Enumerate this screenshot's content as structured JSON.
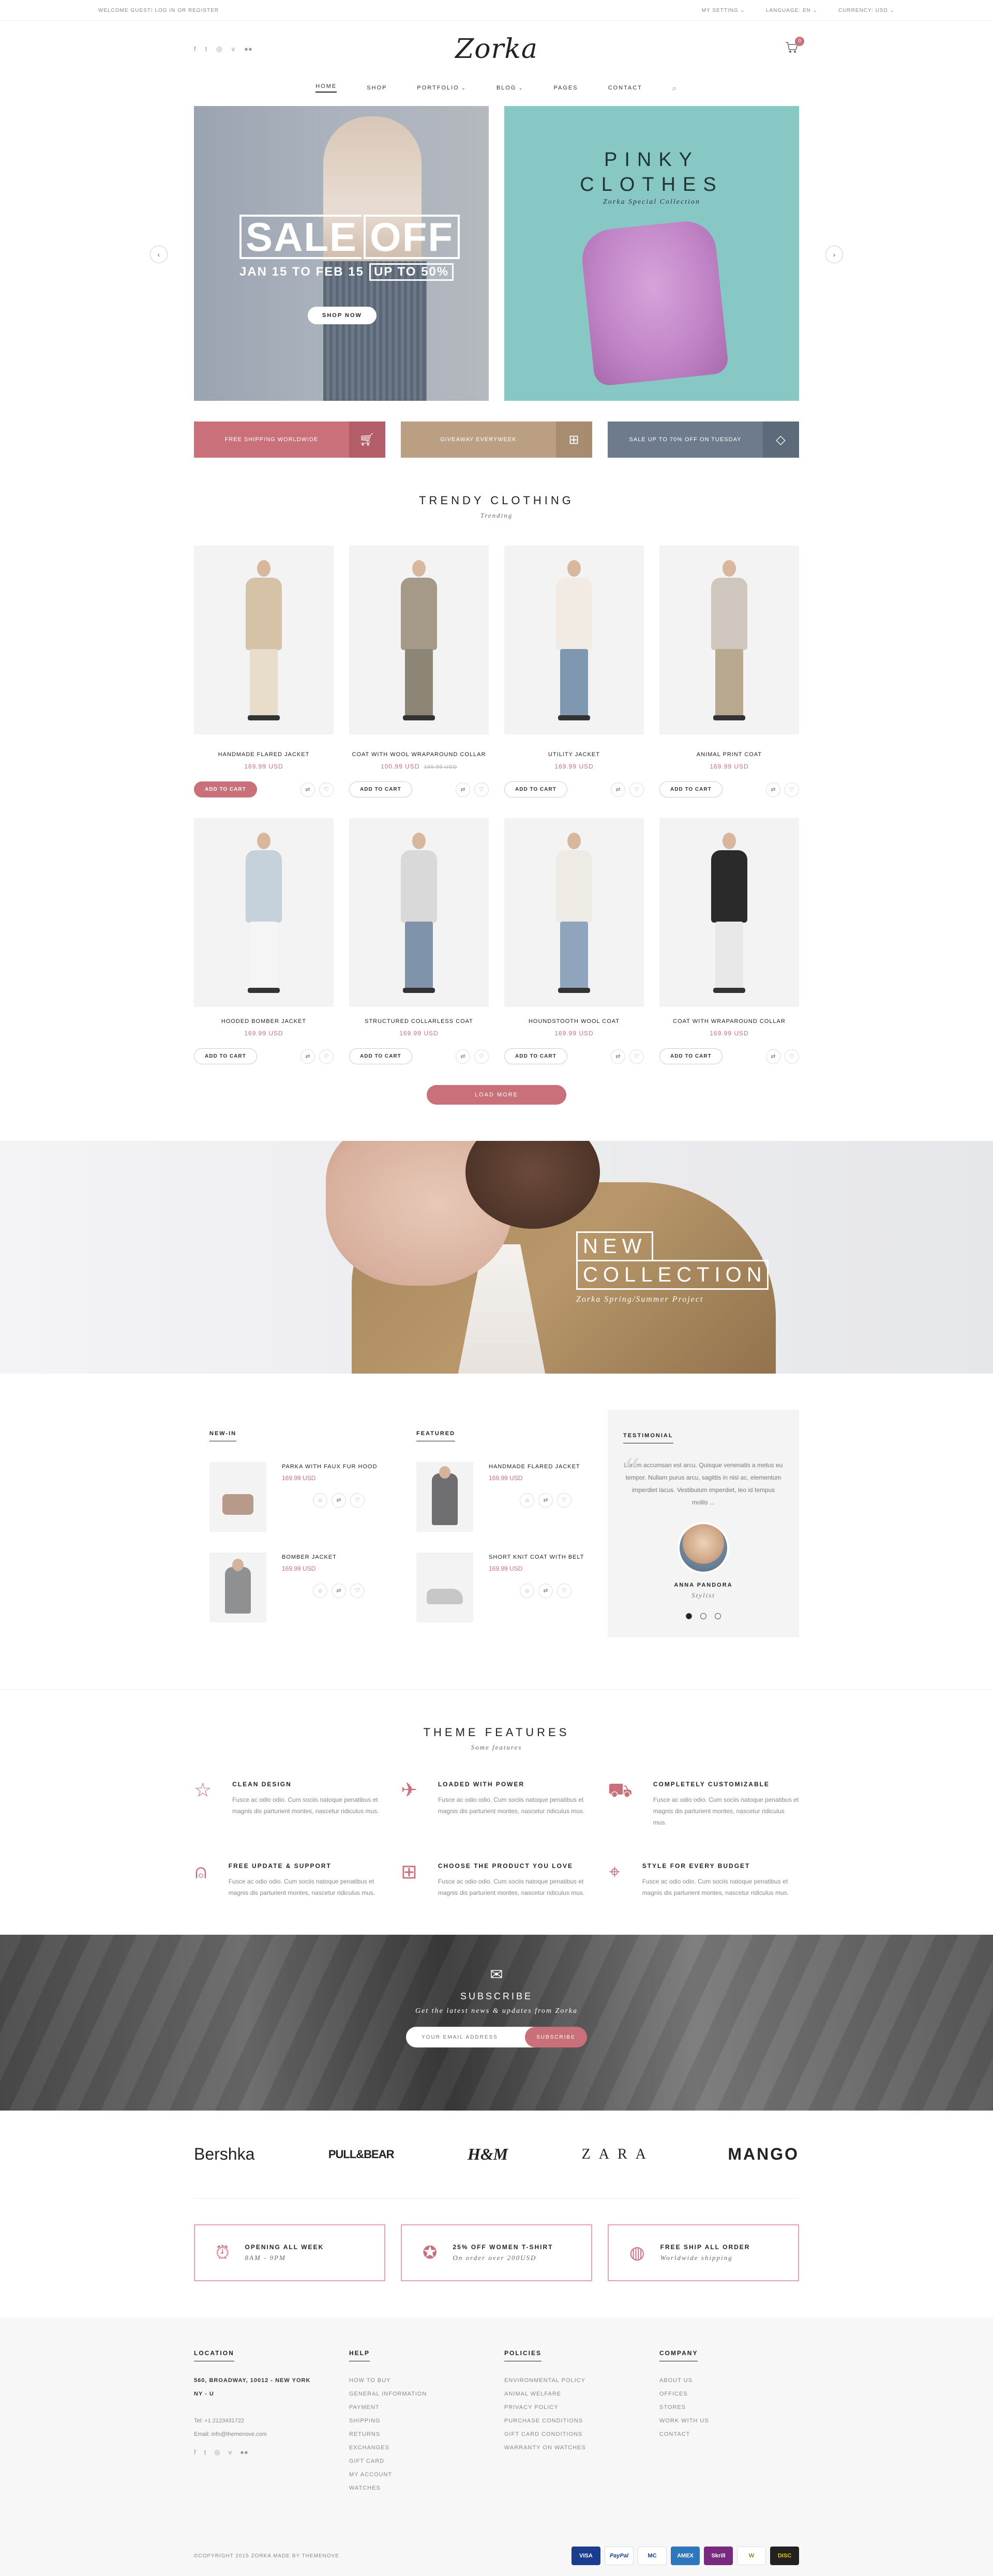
{
  "topbar": {
    "welcome": "WELCOME GUEST! LOG IN OR REGISTER",
    "my_setting": "MY SETTING",
    "language": "LANGUAGE: EN",
    "currency": "CURRENCY: USD"
  },
  "header": {
    "logo": "Zorka",
    "cart_count": "0"
  },
  "nav": {
    "items": [
      "HOME",
      "SHOP",
      "PORTFOLIO",
      "BLOG",
      "PAGES",
      "CONTACT"
    ]
  },
  "hero": {
    "sale_word1": "SALE",
    "sale_word2": "OFF",
    "dates": "JAN 15 TO FEB 15",
    "discount": "UP TO 50%",
    "shop_now": "SHOP NOW",
    "pinky_line1": "PINKY",
    "pinky_line2": "CLOTHES",
    "pinky_sub": "Zorka Special Collection"
  },
  "info_boxes": [
    {
      "text": "FREE SHIPPING WORLDWIDE",
      "icon": "cart-icon"
    },
    {
      "text": "GIVEAWAY EVERYWEEK",
      "icon": "gift-icon"
    },
    {
      "text": "SALE UP TO 70% OFF ON TUESDAY",
      "icon": "diamond-icon"
    }
  ],
  "trendy": {
    "title": "TRENDY CLOTHING",
    "subtitle": "Trending",
    "add_to_cart": "ADD TO CART",
    "load_more": "LOAD MORE",
    "products": [
      {
        "name": "HANDMADE FLARED JACKET",
        "price": "169.99 USD",
        "old": ""
      },
      {
        "name": "COAT WITH WOOL WRAPAROUND COLLAR",
        "price": "100.99 USD",
        "old": "169.99 USD"
      },
      {
        "name": "UTILITY JACKET",
        "price": "169.99 USD",
        "old": ""
      },
      {
        "name": "ANIMAL PRINT COAT",
        "price": "169.99 USD",
        "old": ""
      },
      {
        "name": "HOODED BOMBER JACKET",
        "price": "169.99 USD",
        "old": ""
      },
      {
        "name": "STRUCTURED COLLARLESS COAT",
        "price": "169.99 USD",
        "old": ""
      },
      {
        "name": "HOUNDSTOOTH WOOL COAT",
        "price": "169.99 USD",
        "old": ""
      },
      {
        "name": "COAT WITH WRAPAROUND COLLAR",
        "price": "169.99 USD",
        "old": ""
      }
    ]
  },
  "collection": {
    "line1": "NEW",
    "line2": "COLLECTION",
    "sub": "Zorka Spring/Summer Project"
  },
  "lists": {
    "new_in_title": "NEW-IN",
    "featured_title": "FEATURED",
    "testimonial_title": "TESTIMONIAL",
    "new_in": [
      {
        "name": "PARKA WITH FAUX FUR HOOD",
        "price": "169.99 USD"
      },
      {
        "name": "BOMBER JACKET",
        "price": "169.99 USD"
      }
    ],
    "featured": [
      {
        "name": "HANDMADE FLARED JACKET",
        "price": "169.99 USD"
      },
      {
        "name": "SHORT KNIT COAT WITH BELT",
        "price": "169.99 USD"
      }
    ],
    "testimonial": {
      "quote": "Lorem accumsan est arcu. Quisque venenatis a metus eu tempor. Nullam purus arcu, sagittis in nisl ac, elementum imperdiet lacus. Vestibulum imperdiet, leo id tempus mollis ...",
      "name": "ANNA PANDORA",
      "role": "Stylist"
    }
  },
  "features": {
    "title": "THEME FEATURES",
    "subtitle": "Some features",
    "items": [
      {
        "title": "CLEAN DESIGN",
        "text": "Fusce ac odio odio. Cum sociis natoque penatibus et magnis dis parturient montes, nascetur ridiculus mus.",
        "icon": "star-icon"
      },
      {
        "title": "LOADED WITH POWER",
        "text": "Fusce ac odio odio. Cum sociis natoque penatibus et magnis dis parturient montes, nascetur ridiculus mus.",
        "icon": "rocket-icon"
      },
      {
        "title": "COMPLETELY CUSTOMIZABLE",
        "text": "Fusce ac odio odio. Cum sociis natoque penatibus et magnis dis parturient montes, nascetur ridiculus mus.",
        "icon": "cart-icon"
      },
      {
        "title": "FREE UPDATE & SUPPORT",
        "text": "Fusce ac odio odio. Cum sociis natoque penatibus et magnis dis parturient montes, nascetur ridiculus mus.",
        "icon": "mouse-icon"
      },
      {
        "title": "CHOOSE THE PRODUCT YOU LOVE",
        "text": "Fusce ac odio odio. Cum sociis natoque penatibus et magnis dis parturient montes, nascetur ridiculus mus.",
        "icon": "gift-icon"
      },
      {
        "title": "STYLE FOR EVERY BUDGET",
        "text": "Fusce ac odio odio. Cum sociis natoque penatibus et magnis dis parturient montes, nascetur ridiculus mus.",
        "icon": "tag-icon"
      }
    ]
  },
  "subscribe": {
    "title": "SUBSCRIBE",
    "sub": "Get the latest news & updates from Zorka",
    "placeholder": "YOUR EMAIL ADDRESS",
    "button": "SUBSCRIBE"
  },
  "brands": [
    "Bershka",
    "PULL&BEAR",
    "H&M",
    "ZARA",
    "MANGO"
  ],
  "policies": [
    {
      "title": "OPENING ALL WEEK",
      "sub": "8AM - 9PM",
      "icon": "alarm-clock-icon"
    },
    {
      "title": "25% OFF WOMEN T-SHIRT",
      "sub": "On order over 200USD",
      "icon": "medal-icon"
    },
    {
      "title": "FREE SHIP ALL ORDER",
      "sub": "Worldwide shipping",
      "icon": "globe-icon"
    }
  ],
  "footer": {
    "location_title": "LOCATION",
    "address1": "560, BROADWAY, 10012 - NEW YORK",
    "address2": "NY - U",
    "phone": "Tel: +1 2123431722",
    "email": "Email: info@themenove.com",
    "help_title": "HELP",
    "help": [
      "HOW TO BUY",
      "GENERAL INFORMATION",
      "PAYMENT",
      "SHIPPING",
      "RETURNS",
      "EXCHANGES",
      "GIFT CARD",
      "MY ACCOUNT",
      "WATCHES"
    ],
    "policies_title": "POLICIES",
    "policies": [
      "ENVIRONMENTAL POLICY",
      "ANIMAL WELFARE",
      "PRIVACY POLICY",
      "PURCHASE CONDITIONS",
      "GIFT CARD CONDITIONS",
      "WARRANTY ON WATCHES"
    ],
    "company_title": "COMPANY",
    "company": [
      "ABOUT US",
      "OFFICES",
      "STORES",
      "WORK WITH US",
      "CONTACT"
    ],
    "copyright": "©COPYRIGHT 2015 ZORKA MADE BY THEMENOVE",
    "payments": [
      "VISA",
      "PayPal",
      "MC",
      "AMEX",
      "Skrill",
      "W",
      "DISC"
    ]
  }
}
